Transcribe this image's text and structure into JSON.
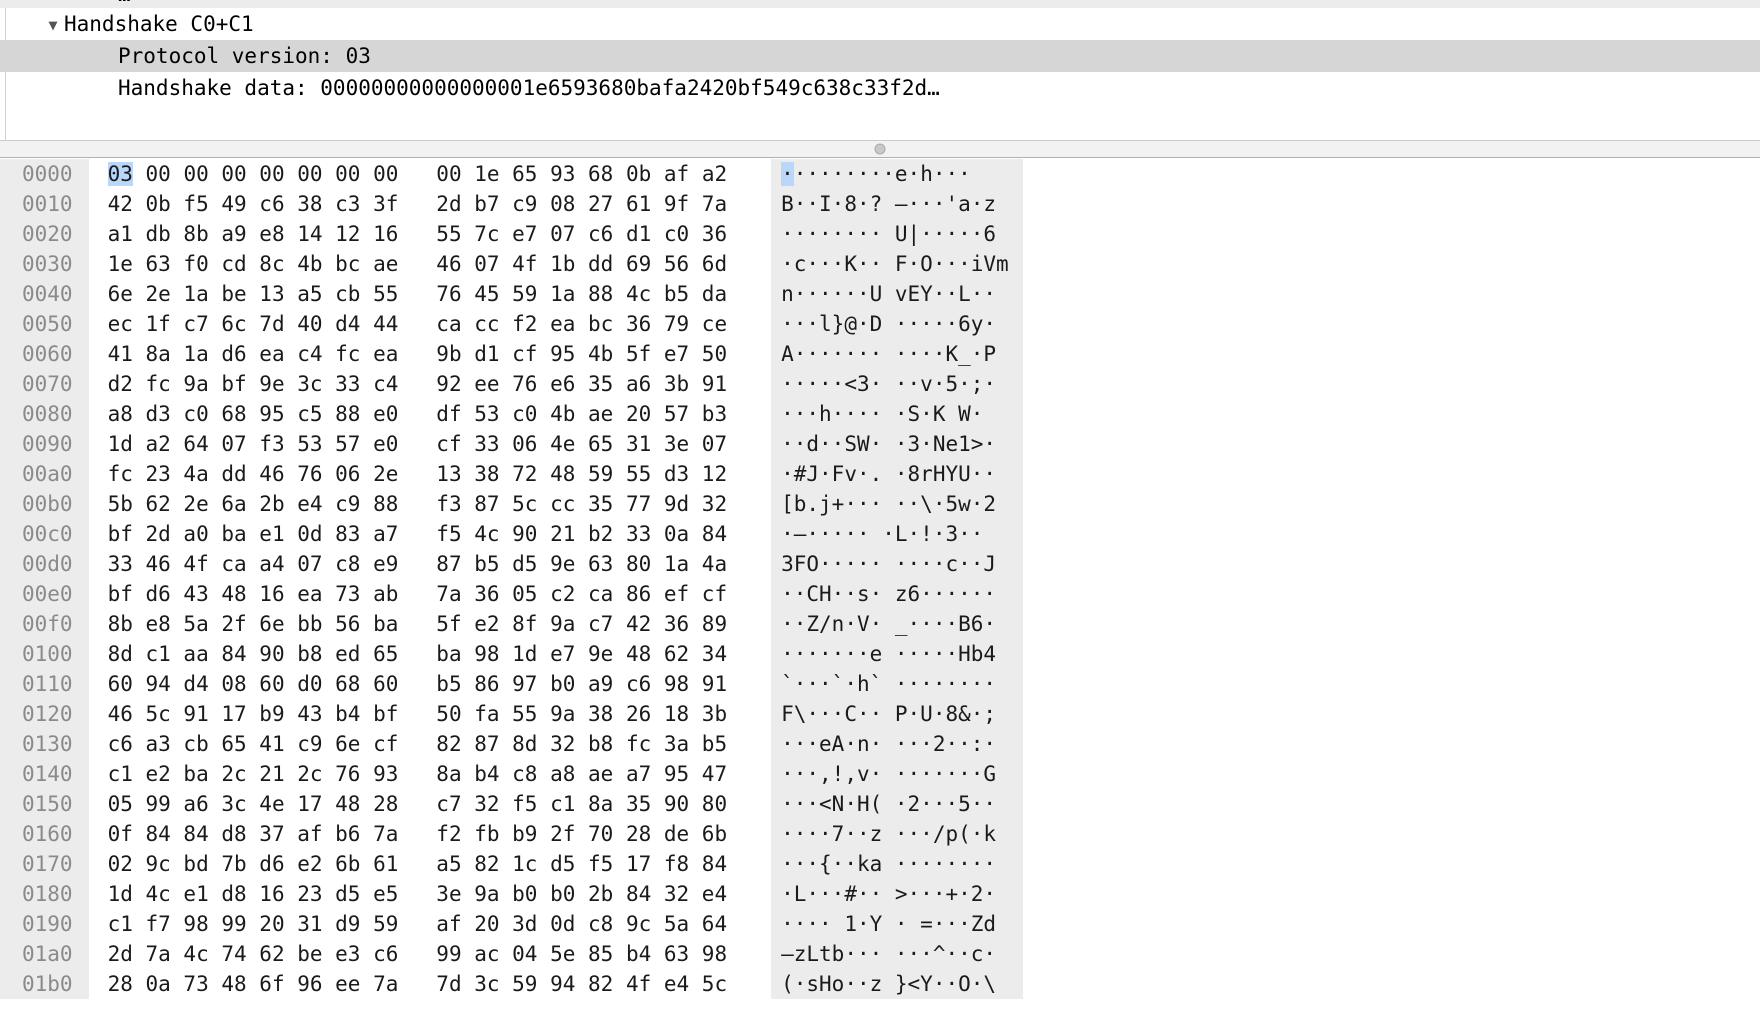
{
  "detail_tree": {
    "ghost_row_text": "…",
    "rows": [
      {
        "name": "handshake-node",
        "expander": "▼",
        "indent": 1,
        "label": "Handshake C0+C1",
        "selected": false
      },
      {
        "name": "protocol-version-field",
        "expander": "",
        "indent": 2,
        "label": "Protocol version: 03",
        "selected": true
      },
      {
        "name": "handshake-data-field",
        "expander": "",
        "indent": 2,
        "label": "Handshake data: 00000000000000001e6593680bafa2420bf549c638c33f2d…",
        "selected": false
      }
    ]
  },
  "splitter": {
    "grip_icon": "drag-handle-icon"
  },
  "hex_dump": {
    "selected_byte_offset": 0,
    "selection_color": "#b9d6fb",
    "rows": [
      {
        "offset": "0000",
        "left": "03 00 00 00 00 00 00 00",
        "right": "00 1e 65 93 68 0b af a2",
        "ascii": "·········e·h···"
      },
      {
        "offset": "0010",
        "left": "42 0b f5 49 c6 38 c3 3f",
        "right": "2d b7 c9 08 27 61 9f 7a",
        "ascii": "B··I·8·? —···'a·z"
      },
      {
        "offset": "0020",
        "left": "a1 db 8b a9 e8 14 12 16",
        "right": "55 7c e7 07 c6 d1 c0 36",
        "ascii": "········ U|·····6"
      },
      {
        "offset": "0030",
        "left": "1e 63 f0 cd 8c 4b bc ae",
        "right": "46 07 4f 1b dd 69 56 6d",
        "ascii": "·c···K·· F·O···iVm"
      },
      {
        "offset": "0040",
        "left": "6e 2e 1a be 13 a5 cb 55",
        "right": "76 45 59 1a 88 4c b5 da",
        "ascii": "n······U vEY··L··"
      },
      {
        "offset": "0050",
        "left": "ec 1f c7 6c 7d 40 d4 44",
        "right": "ca cc f2 ea bc 36 79 ce",
        "ascii": "···l}@·D ·····6y·"
      },
      {
        "offset": "0060",
        "left": "41 8a 1a d6 ea c4 fc ea",
        "right": "9b d1 cf 95 4b 5f e7 50",
        "ascii": "A······· ····K_·P"
      },
      {
        "offset": "0070",
        "left": "d2 fc 9a bf 9e 3c 33 c4",
        "right": "92 ee 76 e6 35 a6 3b 91",
        "ascii": "·····<3· ··v·5·;·"
      },
      {
        "offset": "0080",
        "left": "a8 d3 c0 68 95 c5 88 e0",
        "right": "df 53 c0 4b ae 20 57 b3",
        "ascii": "···h···· ·S·K W·"
      },
      {
        "offset": "0090",
        "left": "1d a2 64 07 f3 53 57 e0",
        "right": "cf 33 06 4e 65 31 3e 07",
        "ascii": "··d··SW· ·3·Ne1>·"
      },
      {
        "offset": "00a0",
        "left": "fc 23 4a dd 46 76 06 2e",
        "right": "13 38 72 48 59 55 d3 12",
        "ascii": "·#J·Fv·. ·8rHYU··"
      },
      {
        "offset": "00b0",
        "left": "5b 62 2e 6a 2b e4 c9 88",
        "right": "f3 87 5c cc 35 77 9d 32",
        "ascii": "[b.j+··· ··\\·5w·2"
      },
      {
        "offset": "00c0",
        "left": "bf 2d a0 ba e1 0d 83 a7",
        "right": "f5 4c 90 21 b2 33 0a 84",
        "ascii": "·—····· ·L·!·3··"
      },
      {
        "offset": "00d0",
        "left": "33 46 4f ca a4 07 c8 e9",
        "right": "87 b5 d5 9e 63 80 1a 4a",
        "ascii": "3FO····· ····c··J"
      },
      {
        "offset": "00e0",
        "left": "bf d6 43 48 16 ea 73 ab",
        "right": "7a 36 05 c2 ca 86 ef cf",
        "ascii": "··CH··s· z6······"
      },
      {
        "offset": "00f0",
        "left": "8b e8 5a 2f 6e bb 56 ba",
        "right": "5f e2 8f 9a c7 42 36 89",
        "ascii": "··Z/n·V· _····B6·"
      },
      {
        "offset": "0100",
        "left": "8d c1 aa 84 90 b8 ed 65",
        "right": "ba 98 1d e7 9e 48 62 34",
        "ascii": "·······e ·····Hb4"
      },
      {
        "offset": "0110",
        "left": "60 94 d4 08 60 d0 68 60",
        "right": "b5 86 97 b0 a9 c6 98 91",
        "ascii": "`···`·h` ········"
      },
      {
        "offset": "0120",
        "left": "46 5c 91 17 b9 43 b4 bf",
        "right": "50 fa 55 9a 38 26 18 3b",
        "ascii": "F\\···C·· P·U·8&·;"
      },
      {
        "offset": "0130",
        "left": "c6 a3 cb 65 41 c9 6e cf",
        "right": "82 87 8d 32 b8 fc 3a b5",
        "ascii": "···eA·n· ···2··:·"
      },
      {
        "offset": "0140",
        "left": "c1 e2 ba 2c 21 2c 76 93",
        "right": "8a b4 c8 a8 ae a7 95 47",
        "ascii": "···,!,v· ·······G"
      },
      {
        "offset": "0150",
        "left": "05 99 a6 3c 4e 17 48 28",
        "right": "c7 32 f5 c1 8a 35 90 80",
        "ascii": "···<N·H( ·2···5··"
      },
      {
        "offset": "0160",
        "left": "0f 84 84 d8 37 af b6 7a",
        "right": "f2 fb b9 2f 70 28 de 6b",
        "ascii": "····7··z ···/p(·k"
      },
      {
        "offset": "0170",
        "left": "02 9c bd 7b d6 e2 6b 61",
        "right": "a5 82 1c d5 f5 17 f8 84",
        "ascii": "···{··ka ········"
      },
      {
        "offset": "0180",
        "left": "1d 4c e1 d8 16 23 d5 e5",
        "right": "3e 9a b0 b0 2b 84 32 e4",
        "ascii": "·L···#·· >···+·2·"
      },
      {
        "offset": "0190",
        "left": "c1 f7 98 99 20 31 d9 59",
        "right": "af 20 3d 0d c8 9c 5a 64",
        "ascii": "···· 1·Y · =···Zd"
      },
      {
        "offset": "01a0",
        "left": "2d 7a 4c 74 62 be e3 c6",
        "right": "99 ac 04 5e 85 b4 63 98",
        "ascii": "—zLtb··· ···^··c·"
      },
      {
        "offset": "01b0",
        "left": "28 0a 73 48 6f 96 ee 7a",
        "right": "7d 3c 59 94 82 4f e4 5c",
        "ascii": "(·sHo··z }<Y··O·\\"
      }
    ]
  }
}
